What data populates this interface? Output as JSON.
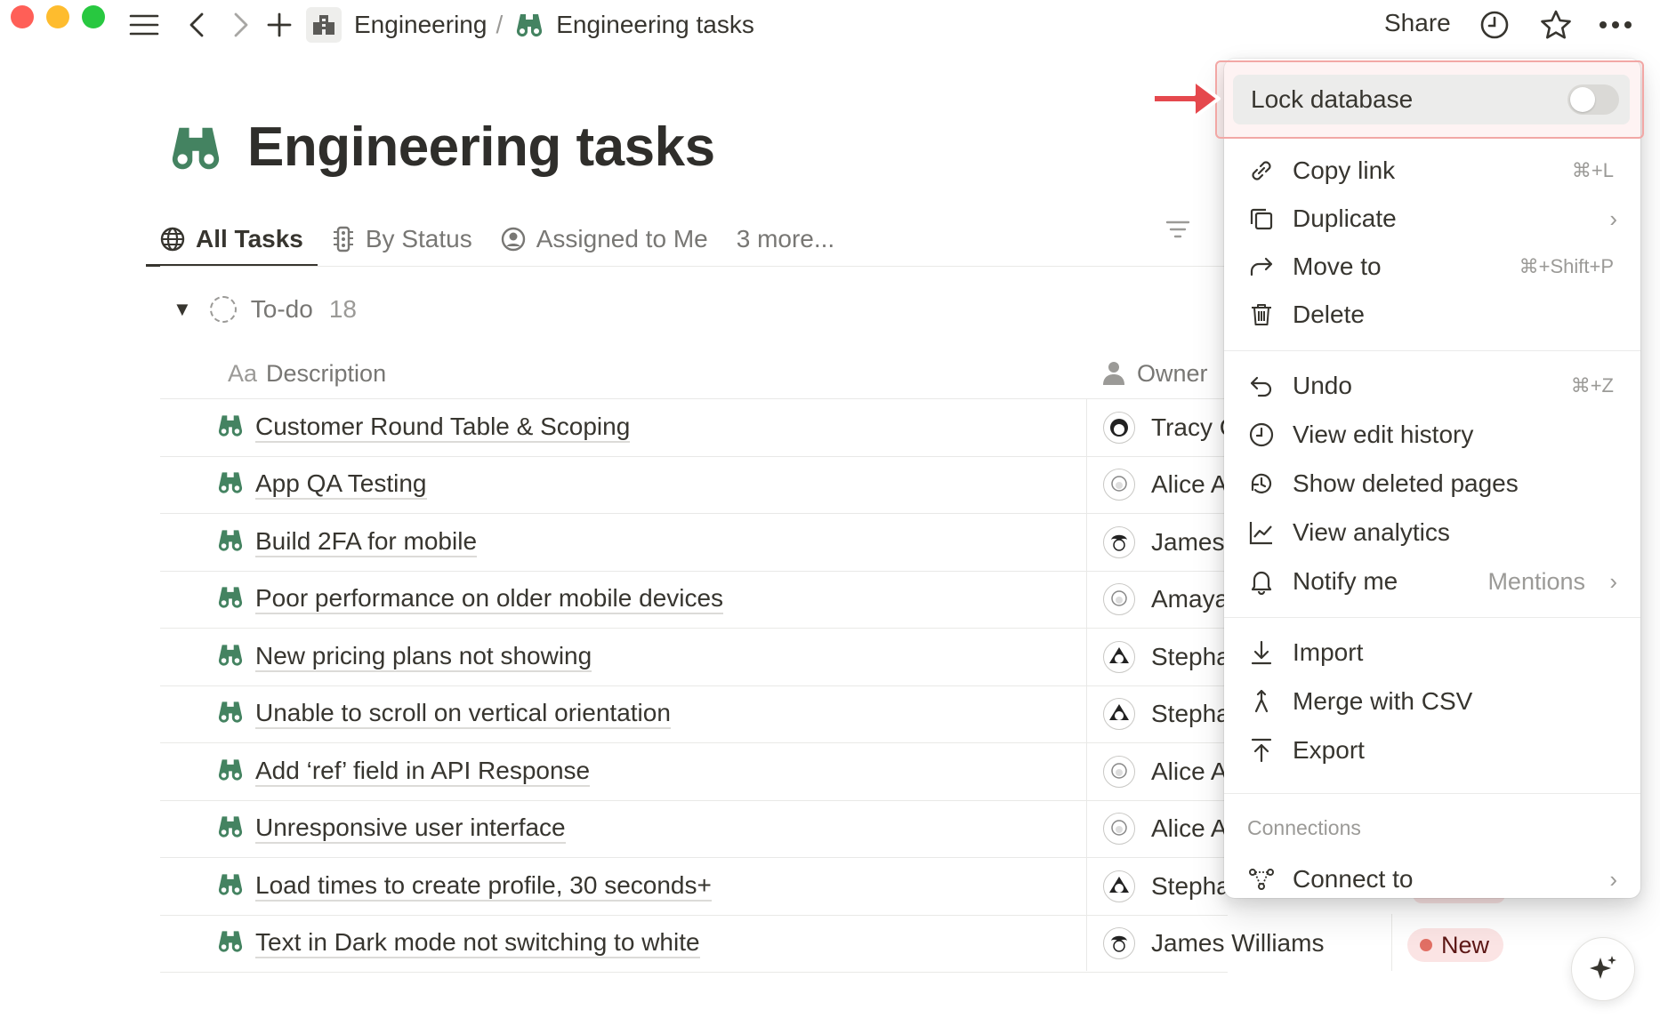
{
  "topbar": {
    "breadcrumb_parent": "Engineering",
    "breadcrumb_separator": "/",
    "breadcrumb_current": "Engineering tasks",
    "share_label": "Share"
  },
  "page": {
    "title": "Engineering tasks",
    "tabs": [
      {
        "label": "All Tasks",
        "active": true
      },
      {
        "label": "By Status",
        "active": false
      },
      {
        "label": "Assigned to Me",
        "active": false
      },
      {
        "label": "3 more...",
        "active": false
      }
    ]
  },
  "group": {
    "name": "To-do",
    "count": "18"
  },
  "columns": {
    "description_prefix": "Aa",
    "description": "Description",
    "owner": "Owner"
  },
  "rows": [
    {
      "title": "Customer Round Table & Scoping",
      "owner": "Tracy C"
    },
    {
      "title": "App QA Testing",
      "owner": "Alice A"
    },
    {
      "title": "Build 2FA for mobile",
      "owner": "James"
    },
    {
      "title": "Poor performance on older mobile devices",
      "owner": "Amaya"
    },
    {
      "title": "New pricing plans not showing",
      "owner": "Stepha"
    },
    {
      "title": "Unable to scroll on vertical orientation",
      "owner": "Stepha"
    },
    {
      "title": "Add ‘ref’ field in API Response",
      "owner": "Alice A"
    },
    {
      "title": "Unresponsive user interface",
      "owner": "Alice A"
    },
    {
      "title": "Load times to create profile, 30 seconds+",
      "owner": "Stepha"
    },
    {
      "title": "Text in Dark mode not switching to white",
      "owner": "James Williams"
    }
  ],
  "status": {
    "label": "New",
    "color": "#e16f64"
  },
  "menu": {
    "lock": {
      "label": "Lock database",
      "enabled": false
    },
    "items": [
      {
        "label": "Copy link",
        "shortcut": "⌘+L",
        "icon": "link-icon"
      },
      {
        "label": "Duplicate",
        "shortcut": "",
        "icon": "duplicate-icon"
      },
      {
        "label": "Move to",
        "shortcut": "⌘+Shift+P",
        "icon": "move-to-icon"
      },
      {
        "label": "Delete",
        "shortcut": "",
        "icon": "trash-icon"
      },
      {
        "label": "Undo",
        "shortcut": "⌘+Z",
        "icon": "undo-icon"
      },
      {
        "label": "View edit history",
        "shortcut": "",
        "icon": "clock-icon"
      },
      {
        "label": "Show deleted pages",
        "shortcut": "",
        "icon": "restore-icon"
      },
      {
        "label": "View analytics",
        "shortcut": "",
        "icon": "chart-icon"
      },
      {
        "label": "Notify me",
        "value": "Mentions",
        "icon": "bell-icon"
      },
      {
        "label": "Import",
        "shortcut": "",
        "icon": "import-icon"
      },
      {
        "label": "Merge with CSV",
        "shortcut": "",
        "icon": "merge-icon"
      },
      {
        "label": "Export",
        "shortcut": "",
        "icon": "export-icon"
      },
      {
        "label": "Connect to",
        "shortcut": "",
        "icon": "connect-icon"
      }
    ],
    "section_connections": "Connections"
  },
  "colors": {
    "accent_red": "#e5484d",
    "brand_green": "#448361"
  }
}
